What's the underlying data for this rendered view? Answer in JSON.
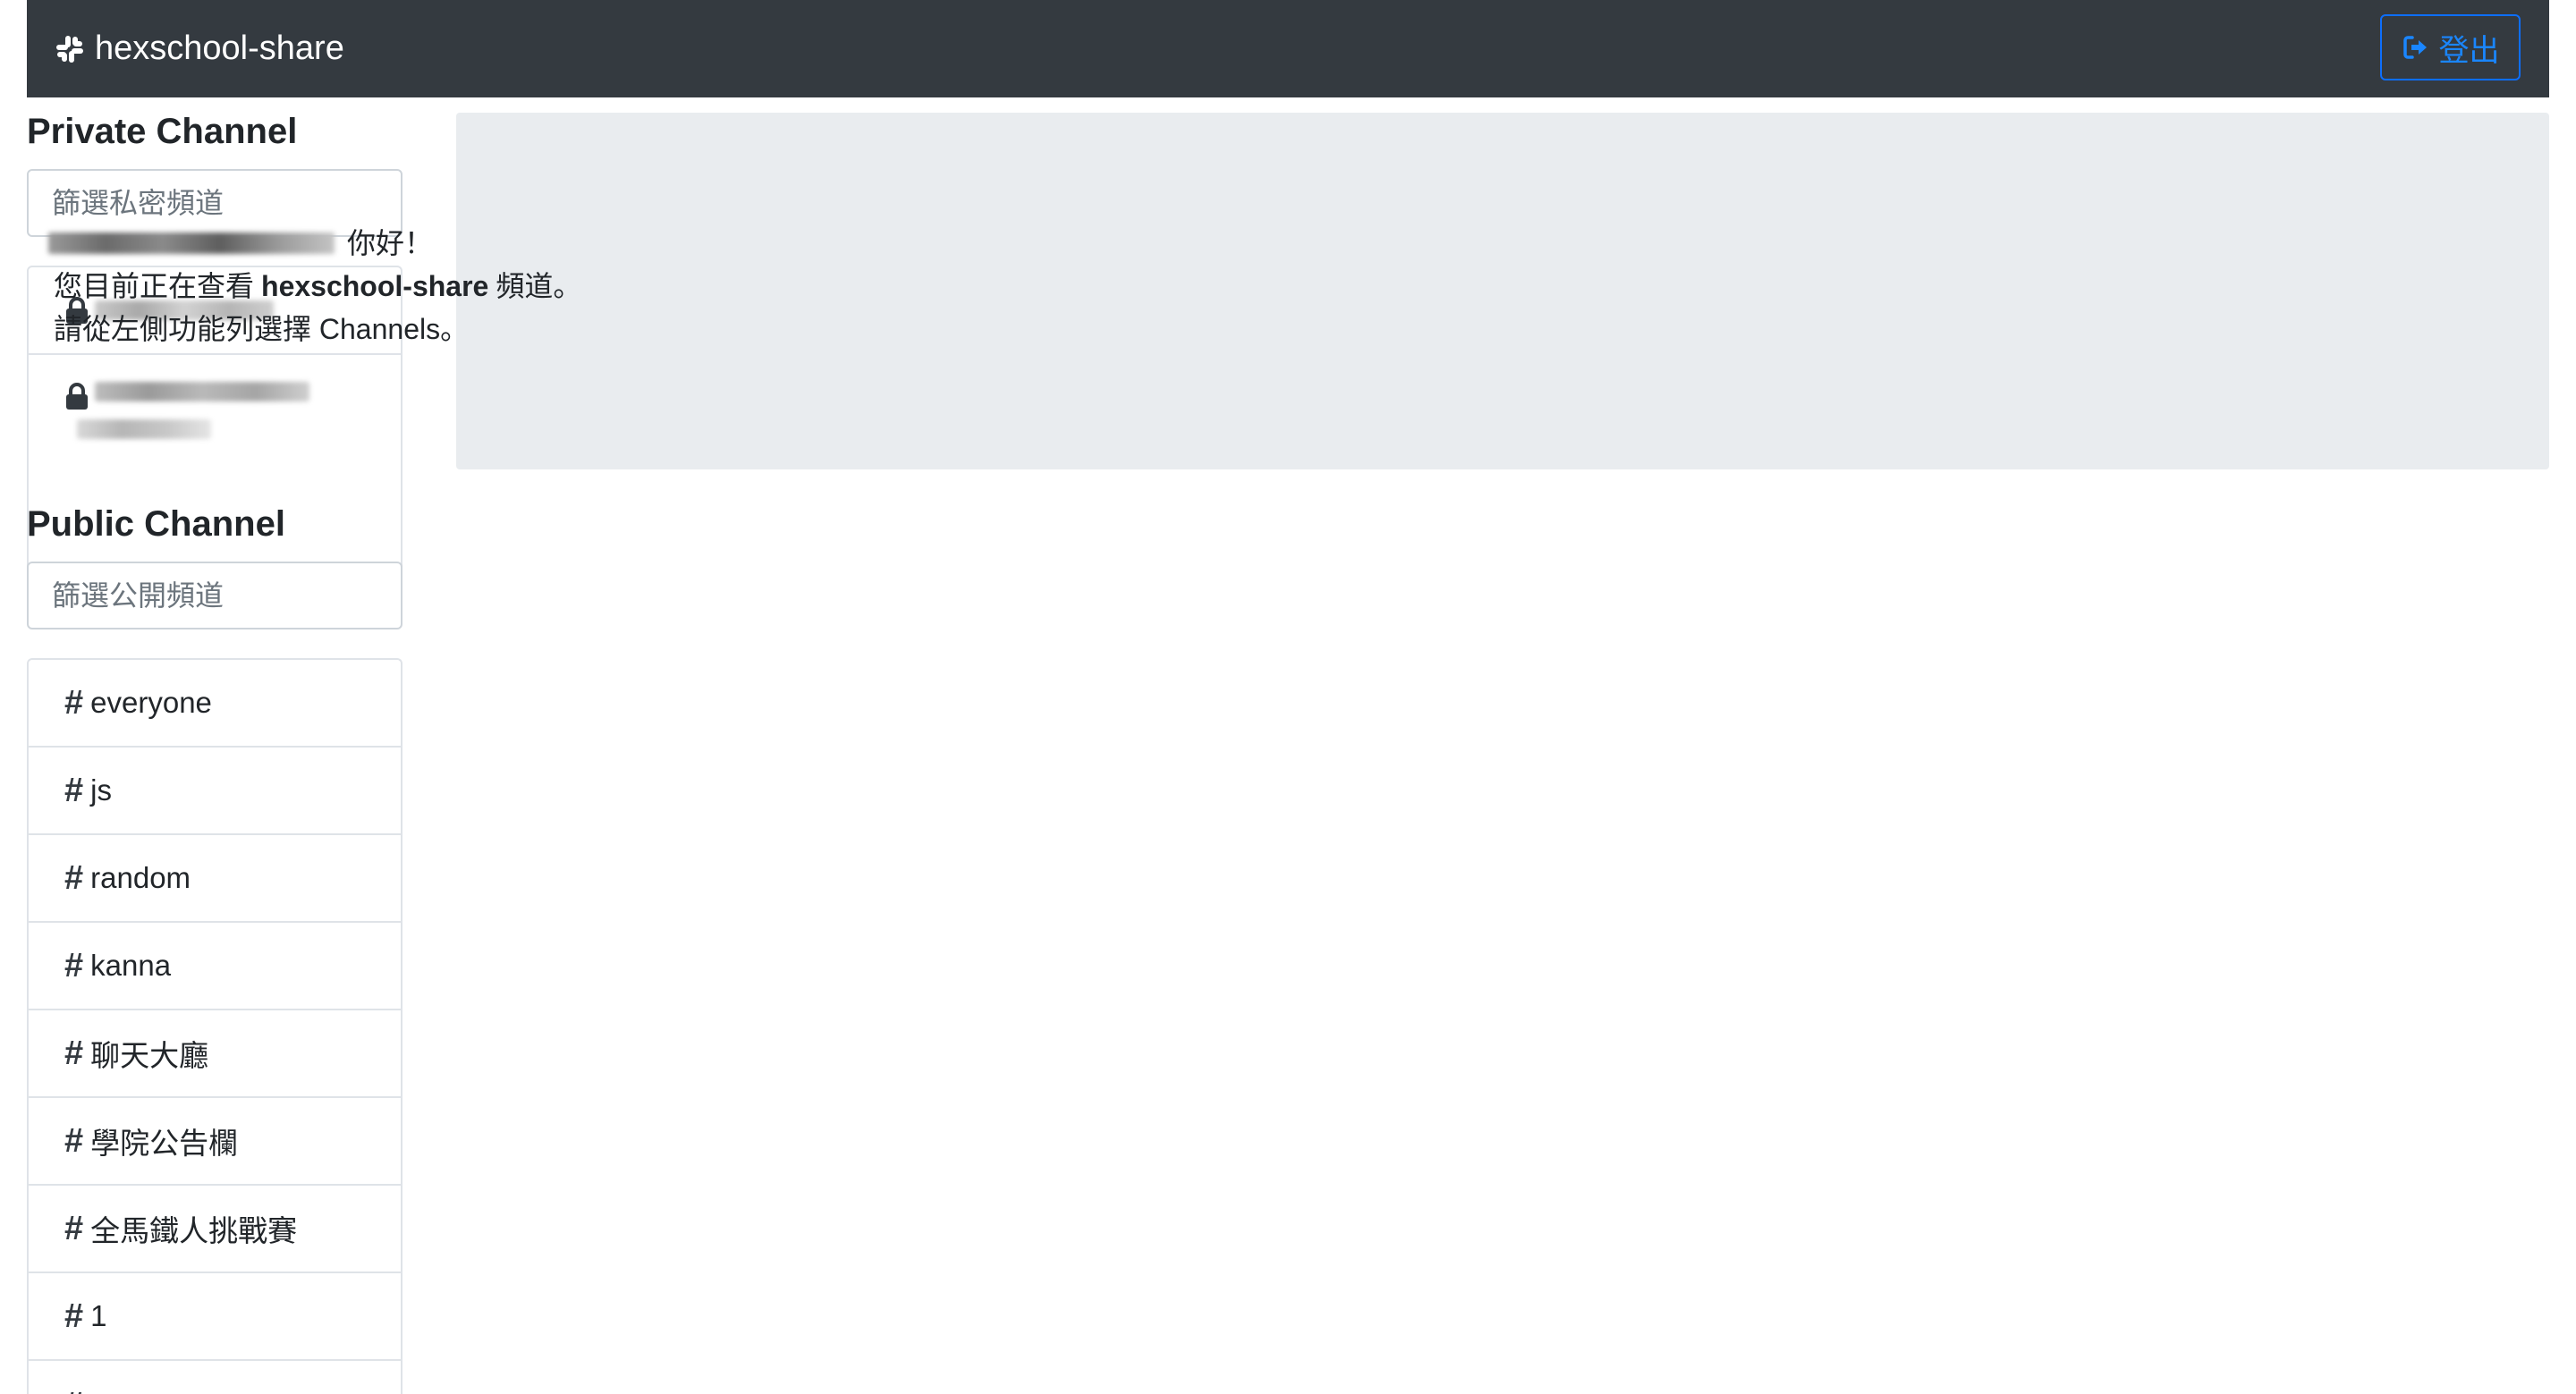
{
  "navbar": {
    "brand": "hexschool-share",
    "brand_icon": "slack-icon",
    "logout_label": "登出",
    "logout_icon": "sign-out-icon",
    "bg_color": "#343a40",
    "accent_color": "#0d6efd"
  },
  "sidebar": {
    "private": {
      "title": "Private Channel",
      "filter_placeholder": "篩選私密頻道",
      "items": [
        {
          "icon": "lock-icon",
          "label": ""
        },
        {
          "icon": "lock-icon",
          "label": ""
        }
      ]
    },
    "public": {
      "title": "Public Channel",
      "filter_placeholder": "篩選公開頻道",
      "items": [
        {
          "prefix": "#",
          "label": "everyone"
        },
        {
          "prefix": "#",
          "label": "js"
        },
        {
          "prefix": "#",
          "label": "random"
        },
        {
          "prefix": "#",
          "label": "kanna"
        },
        {
          "prefix": "#",
          "label": "聊天大廳"
        },
        {
          "prefix": "#",
          "label": "學院公告欄"
        },
        {
          "prefix": "#",
          "label": "全馬鐵人挑戰賽"
        },
        {
          "prefix": "#",
          "label": "1"
        },
        {
          "prefix": "#",
          "label": ""
        }
      ]
    }
  },
  "main": {
    "greeting_suffix": "你好！",
    "viewing_prefix": "您目前正在查看",
    "viewing_channel": "hexschool-share",
    "viewing_suffix": "頻道。",
    "instruction": "請從左側功能列選擇 Channels。",
    "panel_color": "#e9ecef"
  }
}
